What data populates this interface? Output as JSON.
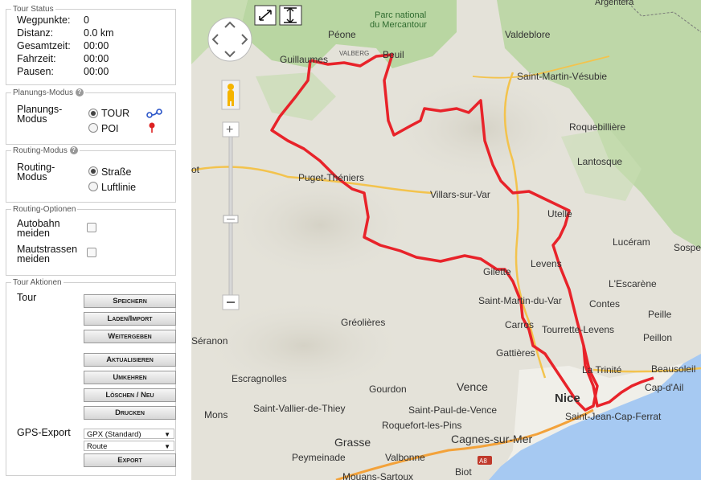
{
  "tour_status": {
    "legend": "Tour Status",
    "rows": [
      {
        "label": "Wegpunkte:",
        "value": "0"
      },
      {
        "label": "Distanz:",
        "value": "0.0 km"
      },
      {
        "label": "Gesamtzeit:",
        "value": "00:00"
      },
      {
        "label": "Fahrzeit:",
        "value": "00:00"
      },
      {
        "label": "Pausen:",
        "value": "00:00"
      }
    ]
  },
  "planning_mode": {
    "legend": "Planungs-Modus",
    "label_line1": "Planungs-",
    "label_line2": "Modus",
    "options": [
      {
        "label": "TOUR",
        "selected": true,
        "icon": "tour-route-icon"
      },
      {
        "label": "POI",
        "selected": false,
        "icon": "poi-pin-icon"
      }
    ]
  },
  "routing_mode": {
    "legend": "Routing-Modus",
    "label_line1": "Routing-",
    "label_line2": "Modus",
    "options": [
      {
        "label": "Straße",
        "selected": true
      },
      {
        "label": "Luftlinie",
        "selected": false
      }
    ]
  },
  "routing_options": {
    "legend": "Routing-Optionen",
    "options": [
      {
        "line1": "Autobahn",
        "line2": "meiden",
        "checked": false
      },
      {
        "line1": "Mautstrassen",
        "line2": "meiden",
        "checked": false
      }
    ]
  },
  "tour_actions": {
    "legend": "Tour Aktionen",
    "tour_label": "Tour",
    "buttons": [
      "Speichern",
      "Laden/Import",
      "Weitergeben",
      "Aktualisieren",
      "Umkehren",
      "Löschen / Neu",
      "Drucken"
    ],
    "gps_label": "GPS-Export",
    "format_select": "GPX (Standard)",
    "type_select": "Route",
    "export_button": "Export"
  },
  "map": {
    "colors": {
      "route": "#e8232a",
      "terrain": "#e4e2d9",
      "forest": "#b9d6a2",
      "sea": "#a6c9f2",
      "road": "#f3c34d"
    },
    "places": [
      "Argentera",
      "Parc national",
      "du Mercantour",
      "Péone",
      "Valdeblore",
      "Guillaumes",
      "VALBERG",
      "Beuil",
      "Saint-Martin-Vésubie",
      "Roquebillière",
      "Lantosque",
      "Puget-Théniers",
      "Villars-sur-Var",
      "Utelle",
      "Lucéram",
      "Sospel",
      "Levens",
      "L'Escarène",
      "Gilette",
      "Contes",
      "Saint-Martin-du-Var",
      "Peille",
      "Carros",
      "Tourrette-Levens",
      "Peillon",
      "Gréolières",
      "Séranon",
      "Gattières",
      "La Trinité",
      "Beausoleil",
      "Escragnolles",
      "Gourdon",
      "Vence",
      "Nice",
      "Cap-d'Ail",
      "Mons",
      "Saint-Vallier-de-Thiey",
      "Saint-Paul-de-Vence",
      "Saint-Jean-Cap-Ferrat",
      "Roquefort-les-Pins",
      "Cagnes-sur-Mer",
      "Grasse",
      "Peymeinade",
      "Valbonne",
      "Biot",
      "Mouans-Sartoux",
      "A8",
      "ot"
    ]
  }
}
